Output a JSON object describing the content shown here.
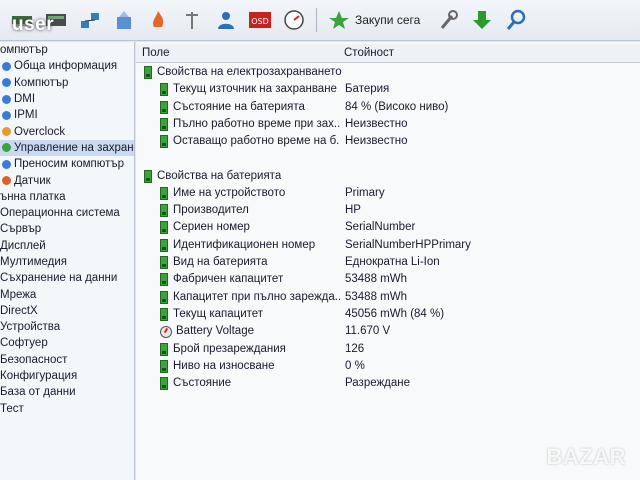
{
  "overlay": {
    "user_label": "user",
    "watermark": "BAZAR"
  },
  "toolbar": {
    "report_label": "Закупи сега"
  },
  "tree": {
    "items": [
      {
        "label": "омпютър",
        "sub": false,
        "color": "#3a7bd5"
      },
      {
        "label": "Обща информация",
        "sub": true,
        "color": "#3a7bd5"
      },
      {
        "label": "Компютър",
        "sub": true,
        "color": "#3a7bd5"
      },
      {
        "label": "DMI",
        "sub": true,
        "color": "#3a7bd5"
      },
      {
        "label": "IPMI",
        "sub": true,
        "color": "#3a7bd5"
      },
      {
        "label": "Overclock",
        "sub": true,
        "color": "#e89b2c"
      },
      {
        "label": "Управление на захранв",
        "sub": true,
        "color": "#3aa33a",
        "selected": true
      },
      {
        "label": "Преносим компютър",
        "sub": true,
        "color": "#3a7bd5"
      },
      {
        "label": "Датчик",
        "sub": true,
        "color": "#d9622b"
      },
      {
        "label": "ънна платка",
        "sub": false,
        "color": "#3a7bd5"
      },
      {
        "label": "Операционна система",
        "sub": false,
        "color": "#3a7bd5"
      },
      {
        "label": "Сървър",
        "sub": false,
        "color": "#3a7bd5"
      },
      {
        "label": "Дисплей",
        "sub": false,
        "color": "#3a7bd5"
      },
      {
        "label": "Мултимедия",
        "sub": false,
        "color": "#3a7bd5"
      },
      {
        "label": "Съхранение на данни",
        "sub": false,
        "color": "#3a7bd5"
      },
      {
        "label": "Мрежа",
        "sub": false,
        "color": "#3a7bd5"
      },
      {
        "label": "DirectX",
        "sub": false,
        "color": "#3a7bd5"
      },
      {
        "label": "Устройства",
        "sub": false,
        "color": "#3a7bd5"
      },
      {
        "label": "Софтуер",
        "sub": false,
        "color": "#3a7bd5"
      },
      {
        "label": "Безопасност",
        "sub": false,
        "color": "#3a7bd5"
      },
      {
        "label": "Конфигурация",
        "sub": false,
        "color": "#3a7bd5"
      },
      {
        "label": "База от данни",
        "sub": false,
        "color": "#3a7bd5"
      },
      {
        "label": "Тест",
        "sub": false,
        "color": "#3a7bd5"
      }
    ]
  },
  "columns": {
    "field": "Поле",
    "value": "Стойност"
  },
  "groups": [
    {
      "title": "Свойства на електрозахранването",
      "rows": [
        {
          "name": "Текущ източник на захранване",
          "value": "Батерия"
        },
        {
          "name": "Състояние на батерията",
          "value": "84 % (Високо ниво)"
        },
        {
          "name": "Пълно работно време при зах...",
          "value": "Неизвестно"
        },
        {
          "name": "Оставащо работно време на б...",
          "value": "Неизвестно"
        }
      ]
    },
    {
      "title": "Свойства на батерията",
      "rows": [
        {
          "name": "Име на устройството",
          "value": "Primary"
        },
        {
          "name": "Производител",
          "value": "HP"
        },
        {
          "name": "Сериен номер",
          "value": "SerialNumber"
        },
        {
          "name": "Идентификационен номер",
          "value": "SerialNumberHPPrimary"
        },
        {
          "name": "Вид на батерията",
          "value": "Еднократна Li-Ion"
        },
        {
          "name": "Фабричен капацитет",
          "value": "53488 mWh"
        },
        {
          "name": "Капацитет при пълно зарежда...",
          "value": "53488 mWh"
        },
        {
          "name": "Текущ капацитет",
          "value": "45056 mWh  (84 %)"
        },
        {
          "name": "Battery Voltage",
          "value": "11.670 V",
          "icon": "voltage-icon"
        },
        {
          "name": "Брой презареждания",
          "value": "126"
        },
        {
          "name": "Ниво на износване",
          "value": "0 %"
        },
        {
          "name": "Състояние",
          "value": "Разреждане"
        }
      ]
    }
  ]
}
